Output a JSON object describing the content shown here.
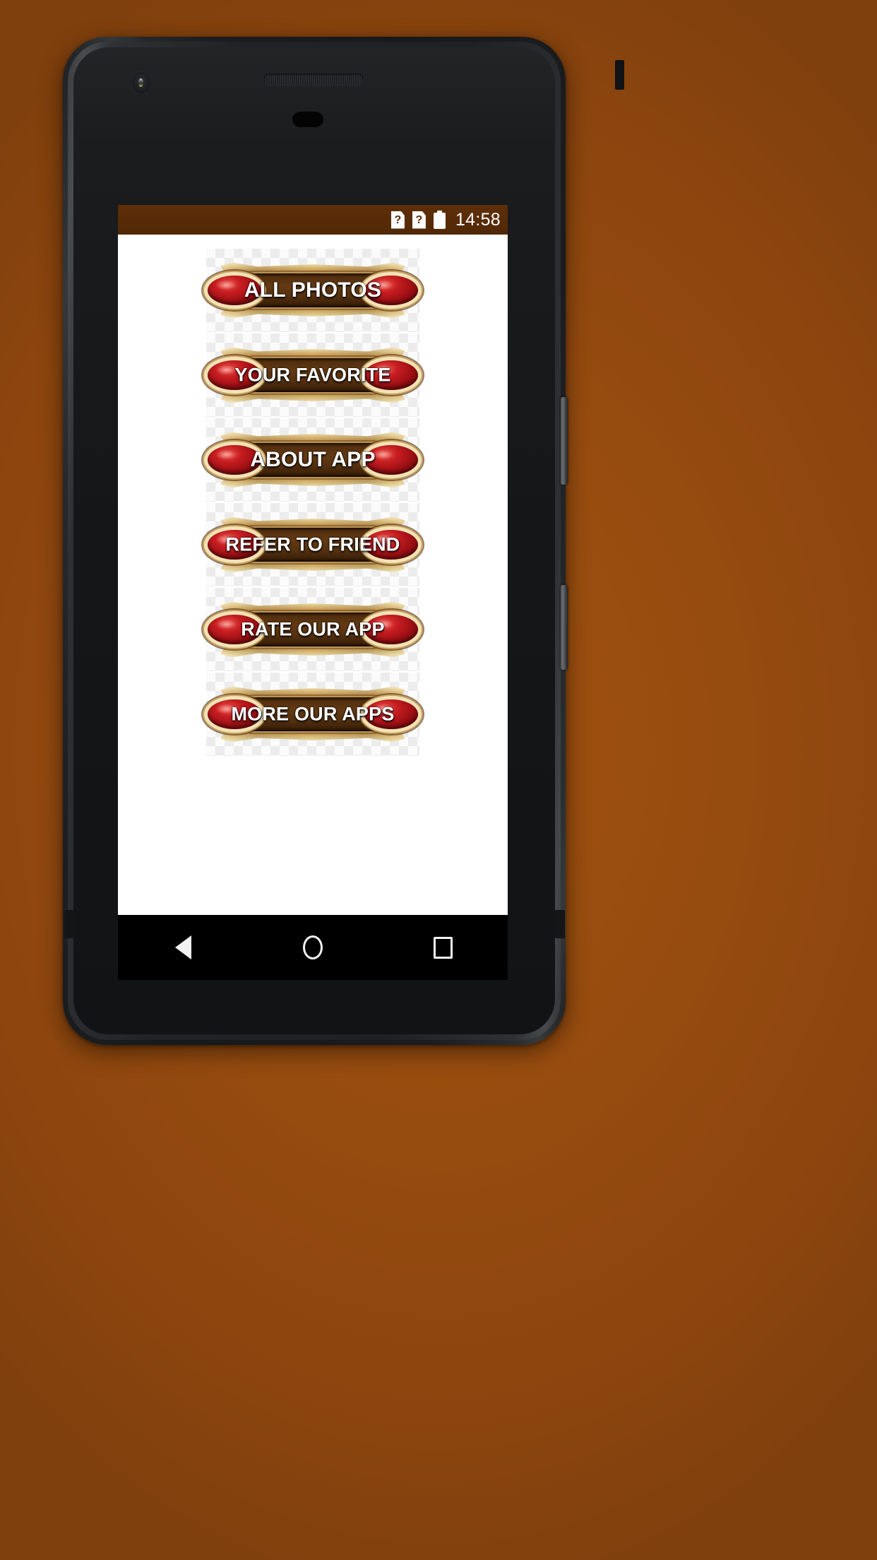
{
  "theme": {
    "backdrop_color": "#97500F",
    "status_bar_color": "#582B07",
    "screen_bg": "#FFFFFF",
    "nav_bar_color": "#000000",
    "accent_gold": "#C99A52",
    "accent_red_gem": "#B41A1E",
    "label_color": "#FFFFFF"
  },
  "status_bar": {
    "icons": [
      {
        "name": "unknown-sim-icon",
        "glyph": "?"
      },
      {
        "name": "unknown-sim-icon",
        "glyph": "?"
      },
      {
        "name": "battery-icon",
        "glyph": ""
      }
    ],
    "time": "14:58"
  },
  "main": {
    "menu_items": [
      {
        "id": "all-photos",
        "label": "ALL PHOTOS"
      },
      {
        "id": "your-favorite",
        "label": "YOUR FAVORITE"
      },
      {
        "id": "about-app",
        "label": "ABOUT APP"
      },
      {
        "id": "refer-to-friend",
        "label": "REFER TO FRIEND"
      },
      {
        "id": "rate-our-app",
        "label": "RATE OUR APP"
      },
      {
        "id": "more-our-apps",
        "label": "MORE OUR APPS"
      }
    ]
  },
  "nav_bar": {
    "buttons": [
      {
        "name": "back-button",
        "icon": "triangle-left-icon"
      },
      {
        "name": "home-button",
        "icon": "circle-icon"
      },
      {
        "name": "recents-button",
        "icon": "square-icon"
      }
    ]
  },
  "device": {
    "hardware": [
      {
        "name": "front-camera"
      },
      {
        "name": "earpiece-speaker"
      },
      {
        "name": "power-button"
      },
      {
        "name": "volume-rocker"
      }
    ]
  }
}
